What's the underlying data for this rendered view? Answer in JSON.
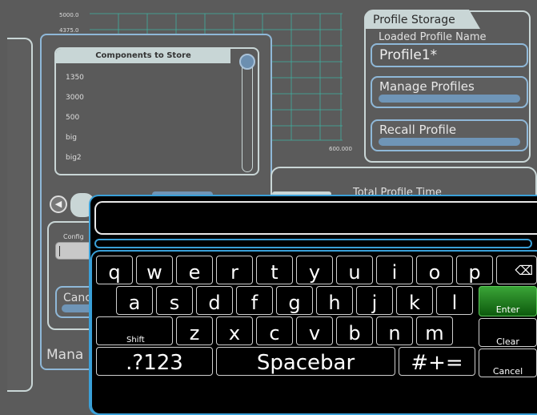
{
  "chart": {
    "y_ticks": [
      "5000.0",
      "4375.0"
    ],
    "x_tick_end": "600.000"
  },
  "components": {
    "title": "Components to Store",
    "items": [
      "1350",
      "3000",
      "500",
      "big",
      "big2"
    ]
  },
  "storage": {
    "title": "Profile Storage",
    "loaded_label": "Loaded Profile Name",
    "loaded_value": "Profile1*",
    "manage_button": "Manage Profiles",
    "recall_button": "Recall Profile"
  },
  "total": {
    "label": "Total Profile Time"
  },
  "config": {
    "label": "Config",
    "cancel_button": "Cancel",
    "manage_label": "Mana"
  },
  "keyboard": {
    "input_value": "",
    "row1": [
      "q",
      "w",
      "e",
      "r",
      "t",
      "y",
      "u",
      "i",
      "o",
      "p"
    ],
    "row2": [
      "a",
      "s",
      "d",
      "f",
      "g",
      "h",
      "j",
      "k",
      "l"
    ],
    "row3": [
      "z",
      "x",
      "c",
      "v",
      "b",
      "n",
      "m"
    ],
    "backspace": "⌫",
    "enter": "Enter",
    "shift": "Shift",
    "clear": "Clear",
    "sym": ".?123",
    "space": "Spacebar",
    "sym2": "#+=",
    "cancel": "Cancel"
  },
  "colors": {
    "accent": "#3aa0d8",
    "enter": "#1f8a1d",
    "panel_border": "#c9d6d6",
    "button_bar": "#6f95b7"
  }
}
